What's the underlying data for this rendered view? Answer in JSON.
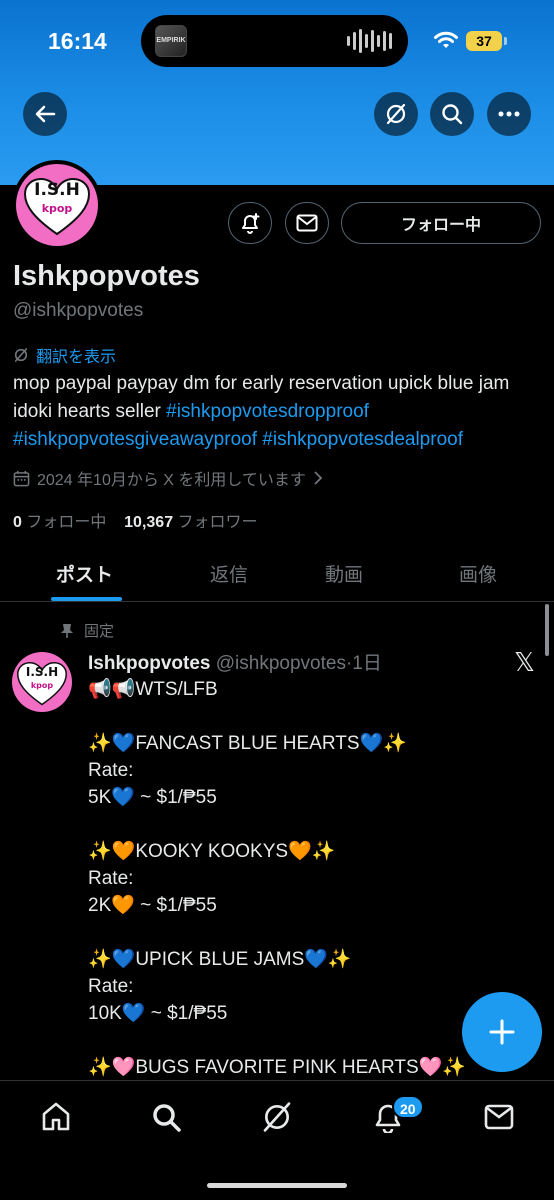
{
  "status_bar": {
    "time": "16:14",
    "battery": "37",
    "island_art_label": "EMPIRIK"
  },
  "header": {
    "back_icon": "arrow-left-icon",
    "grok_icon": "grok-icon",
    "search_icon": "search-icon",
    "more_icon": "more-icon"
  },
  "profile": {
    "avatar_text": "I.S.H",
    "avatar_sub": "kpop",
    "follow_button": "フォロー中",
    "name": "Ishkpopvotes",
    "handle": "@ishkpopvotes",
    "translate": "翻訳を表示",
    "bio_text": "mop paypal paypay dm for early reservation upick blue jam idoki hearts seller ",
    "bio_tags": [
      "#ishkpopvotesdropproof",
      "#ishkpopvotesgiveawayproof",
      "#ishkpopvotesdealproof"
    ],
    "joined": "2024 年10月から X を利用しています",
    "following_count": "0",
    "following_label": "フォロー中",
    "followers_count": "10,367",
    "followers_label": "フォロワー"
  },
  "tabs": [
    {
      "label": "ポスト"
    },
    {
      "label": "返信"
    },
    {
      "label": "動画"
    },
    {
      "label": "画像"
    }
  ],
  "post": {
    "pinned_label": "固定",
    "author": "Ishkpopvotes",
    "handle": "@ishkpopvotes",
    "dot": "·",
    "time": "1日",
    "lines": [
      "📢📢WTS/LFB",
      "",
      "✨💙FANCAST BLUE HEARTS💙✨",
      "Rate:",
      "5K💙 ~ $1/₱55",
      "",
      "✨🧡KOOKY KOOKYS🧡✨",
      "Rate:",
      "2K🧡 ~ $1/₱55",
      "",
      "✨💙UPICK BLUE JAMS💙✨",
      "Rate:",
      "10K💙 ~ $1/₱55",
      "",
      "✨🩷BUGS FAVORITE PINK HEARTS🩷✨"
    ]
  },
  "bottom_nav": {
    "items": [
      "home-icon",
      "search-icon",
      "grok-icon",
      "notifications-icon",
      "messages-icon"
    ],
    "notification_badge": "20"
  },
  "colors": {
    "accent": "#1d9bf0",
    "banner": "#1d8fe8",
    "avatar_pink": "#f16ec4"
  }
}
